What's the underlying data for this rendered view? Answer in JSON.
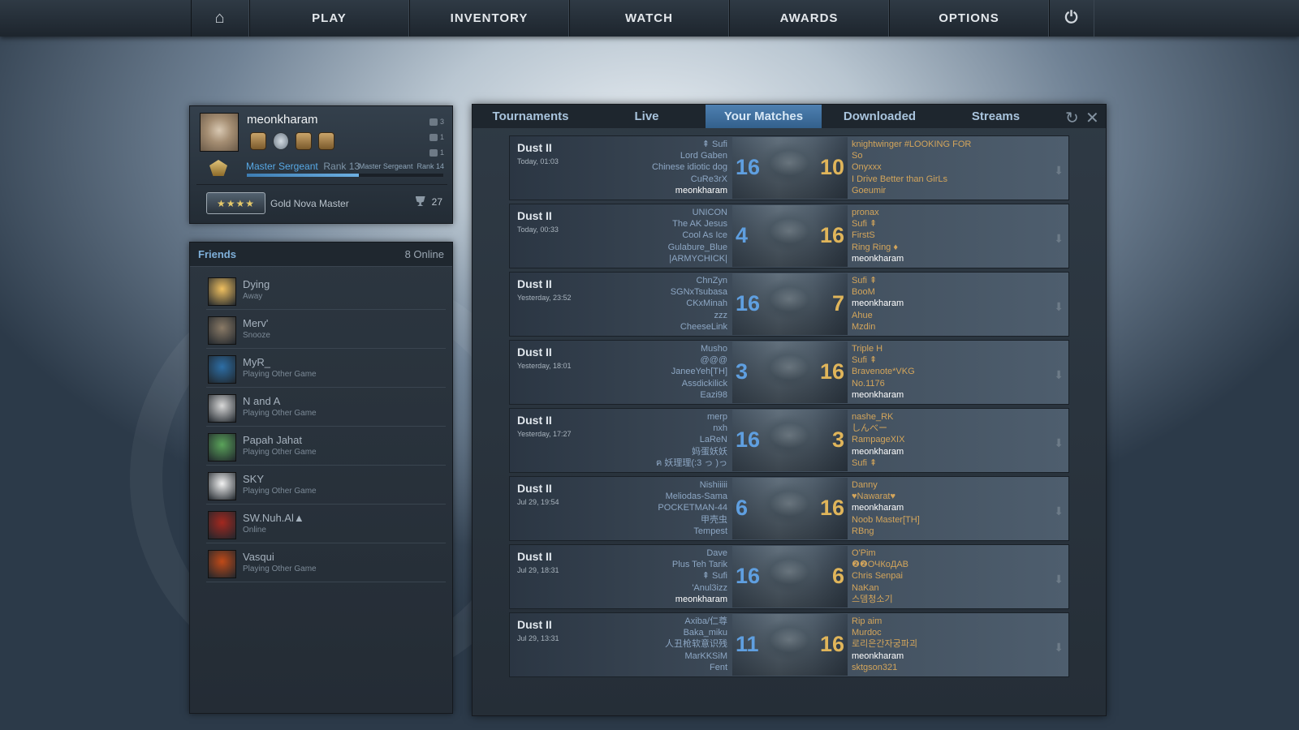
{
  "nav": {
    "home_icon": "home-icon",
    "play": "PLAY",
    "inventory": "INVENTORY",
    "watch": "WATCH",
    "awards": "AWARDS",
    "options": "OPTIONS",
    "power_icon": "power-icon"
  },
  "profile": {
    "username": "meonkharam",
    "stat1": "3",
    "stat2": "1",
    "stat3": "1",
    "rank_name": "Master Sergeant",
    "rank_level": "Rank 13",
    "next_rank_name": "Master Sergeant",
    "next_rank_level": "Rank 14",
    "xp_progress": 0.57,
    "skill_group": "Gold Nova Master",
    "skill_badge_text": "★★★★",
    "wins": "27"
  },
  "friends": {
    "title": "Friends",
    "online": "8 Online",
    "items": [
      {
        "name": "Dying",
        "status": "Away",
        "color": "#f0c060"
      },
      {
        "name": "Merv'",
        "status": "Snooze",
        "color": "#8a7a66"
      },
      {
        "name": "MyR_",
        "status": "Playing Other Game",
        "color": "#2d6ea5"
      },
      {
        "name": "N and A",
        "status": "Playing Other Game",
        "color": "#d8d8d8"
      },
      {
        "name": "Papah Jahat",
        "status": "Playing Other Game",
        "color": "#5aa35a"
      },
      {
        "name": "SKY",
        "status": "Playing Other Game",
        "color": "#f2f2f2"
      },
      {
        "name": "SW.Nuh.Al▲",
        "status": "Online",
        "color": "#a3281f"
      },
      {
        "name": "Vasqui",
        "status": "Playing Other Game",
        "color": "#c04a18"
      }
    ]
  },
  "watch": {
    "tabs": [
      "Tournaments",
      "Live",
      "Your Matches",
      "Downloaded",
      "Streams"
    ],
    "active_tab": "Your Matches",
    "matches": [
      {
        "map": "Dust II",
        "date": "Today, 01:03",
        "score_left": "16",
        "score_right": "10",
        "left": [
          "⇞ Sufi",
          "Lord Gaben",
          "Chinese idiotic dog",
          "CuRe3rX",
          "meonkharam"
        ],
        "right": [
          "knightwinger #LOOKING FOR",
          "So",
          "Onyxxx",
          "I Drive Better than GirLs",
          "Goeumir"
        ]
      },
      {
        "map": "Dust II",
        "date": "Today, 00:33",
        "score_left": "4",
        "score_right": "16",
        "left": [
          "UNICON",
          "The AK Jesus",
          "Cool As Ice",
          "Gulabure_Blue",
          "|ARMYCHICK|"
        ],
        "right": [
          "pronax",
          "Sufi ⇞",
          "FirstS",
          "Ring Ring ♦",
          "meonkharam"
        ]
      },
      {
        "map": "Dust II",
        "date": "Yesterday, 23:52",
        "score_left": "16",
        "score_right": "7",
        "left": [
          "ChnZyn",
          "SGNxTsubasa",
          "CKxMinah",
          "zzz",
          "CheeseLink"
        ],
        "right": [
          "Sufi ⇞",
          "BooM",
          "meonkharam",
          "Ahue",
          "Mzdin"
        ]
      },
      {
        "map": "Dust II",
        "date": "Yesterday, 18:01",
        "score_left": "3",
        "score_right": "16",
        "left": [
          "Musho",
          "@@@",
          "JaneeYeh[TH]",
          "Assdickilick",
          "Eazi98"
        ],
        "right": [
          "Triple H",
          "Sufi ⇞",
          "Bravenote*VKG",
          "No.1176",
          "meonkharam"
        ]
      },
      {
        "map": "Dust II",
        "date": "Yesterday, 17:27",
        "score_left": "16",
        "score_right": "3",
        "left": [
          "merp",
          "nxh",
          "LaReN",
          "妈蛋妖妖",
          "ฅ 妖理理(:3 っ )っ"
        ],
        "right": [
          "nashe_RK",
          "しんべー",
          "RampageXIX",
          "meonkharam",
          "Sufi ⇞"
        ]
      },
      {
        "map": "Dust II",
        "date": "Jul 29, 19:54",
        "score_left": "6",
        "score_right": "16",
        "left": [
          "Nishiiiii",
          "Meliodas-Sama",
          "POCKETMAN-44",
          "甲壳虫",
          "Tempest"
        ],
        "right": [
          "Danny",
          "♥Nawarat♥",
          "meonkharam",
          "Noob Master[TH]",
          "RBng"
        ]
      },
      {
        "map": "Dust II",
        "date": "Jul 29, 18:31",
        "score_left": "16",
        "score_right": "6",
        "left": [
          "Dave",
          "Plus Teh Tarik",
          "⇞ Sufi",
          "'Anul3izz",
          "meonkharam"
        ],
        "right": [
          "O'Pim",
          "❷❷ОЧКоДАВ",
          "Chris Senpai",
          "NaKan",
          "스뎀청소기"
        ]
      },
      {
        "map": "Dust II",
        "date": "Jul 29, 13:31",
        "score_left": "11",
        "score_right": "16",
        "left": [
          "Axiba/仁尊",
          "Baka_miku",
          "人丑枪软意识残",
          "MarKKSiM",
          "Fent"
        ],
        "right": [
          "Rip aim",
          "Murdoc",
          "로리은간자궁파괴",
          "meonkharam",
          "sktgson321"
        ]
      }
    ]
  },
  "colors": {
    "accent_blue": "#4f82b3",
    "ct_blue": "#5f9fe0",
    "t_gold": "#e0b55a"
  }
}
